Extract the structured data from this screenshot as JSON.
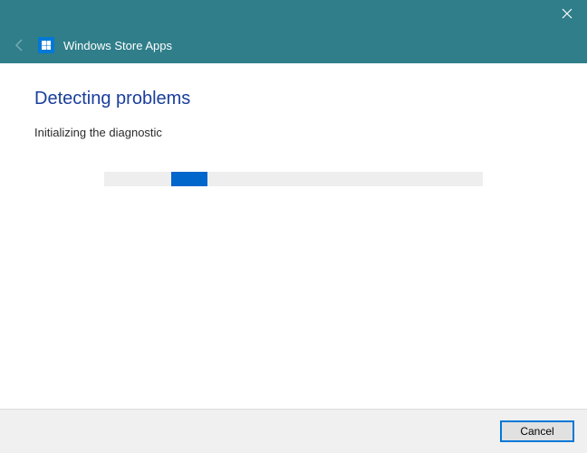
{
  "chrome": {
    "title": "Windows Store Apps"
  },
  "content": {
    "heading": "Detecting problems",
    "subtext": "Initializing the diagnostic"
  },
  "footer": {
    "cancel_label": "Cancel"
  }
}
